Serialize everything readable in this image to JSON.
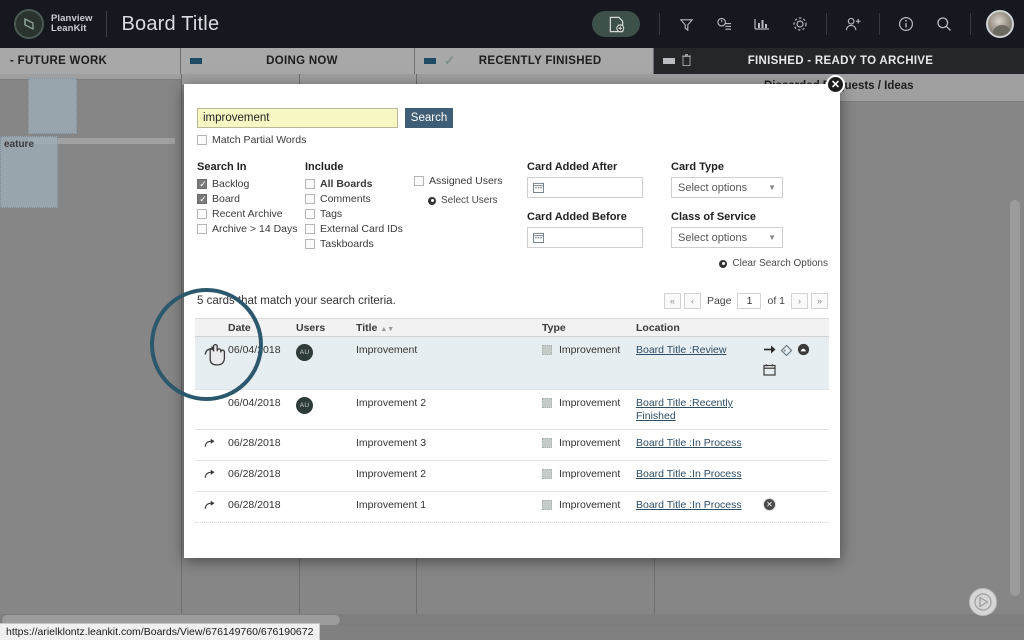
{
  "appbar": {
    "brand_line1": "Planview",
    "brand_line2": "LeanKit",
    "board_title": "Board Title",
    "icons": [
      {
        "name": "add-card-icon",
        "label": "Add Card"
      },
      {
        "name": "filter-icon",
        "label": "Filter"
      },
      {
        "name": "timer-icon",
        "label": "Timeline"
      },
      {
        "name": "analytics-icon",
        "label": "Analytics"
      },
      {
        "name": "gear-icon",
        "label": "Settings"
      },
      {
        "name": "add-user-icon",
        "label": "Add User"
      },
      {
        "name": "info-icon",
        "label": "Info"
      },
      {
        "name": "search-icon",
        "label": "Search"
      },
      {
        "name": "avatar-icon",
        "label": "Account"
      }
    ]
  },
  "board": {
    "lanes": [
      {
        "label": "- FUTURE WORK",
        "collapse": false,
        "check": false,
        "trash": false,
        "dark": false
      },
      {
        "label": "DOING NOW",
        "collapse": true,
        "check": false,
        "trash": false,
        "dark": false
      },
      {
        "label": "RECENTLY FINISHED",
        "collapse": true,
        "check": true,
        "trash": false,
        "dark": false
      },
      {
        "label": "FINISHED - READY TO ARCHIVE",
        "collapse": true,
        "check": false,
        "trash": true,
        "dark": true
      }
    ],
    "sublane_title": "Discarded Requests / Ideas",
    "ghost_card_title": "eature"
  },
  "modal": {
    "close_label": "✕",
    "search": {
      "value": "improvement",
      "placeholder": "",
      "button_label": "Search",
      "match_partial_label": "Match Partial Words",
      "match_partial_checked": false
    },
    "search_in": {
      "heading": "Search In",
      "options": [
        {
          "label": "Backlog",
          "checked": true
        },
        {
          "label": "Board",
          "checked": true
        },
        {
          "label": "Recent Archive",
          "checked": false
        },
        {
          "label": "Archive > 14 Days",
          "checked": false
        }
      ]
    },
    "include": {
      "heading": "Include",
      "options": [
        {
          "label": "All Boards",
          "checked": false,
          "bold": true
        },
        {
          "label": "Comments",
          "checked": false,
          "bold": false
        },
        {
          "label": "Tags",
          "checked": false,
          "bold": false
        },
        {
          "label": "External Card IDs",
          "checked": false,
          "bold": false
        },
        {
          "label": "Taskboards",
          "checked": false,
          "bold": false
        }
      ]
    },
    "users": {
      "assigned_label": "Assigned Users",
      "assigned_checked": false,
      "select_users_label": "Select Users"
    },
    "card_added_after": {
      "heading": "Card Added After",
      "value": ""
    },
    "card_added_before": {
      "heading": "Card Added Before",
      "value": ""
    },
    "card_type": {
      "heading": "Card Type",
      "value": "Select options"
    },
    "class_of_service": {
      "heading": "Class of Service",
      "value": "Select options"
    },
    "clear_search_options": "Clear Search Options",
    "results": {
      "count_text": "5 cards that match your search criteria.",
      "pager": {
        "first": "«",
        "prev": "‹",
        "page_label": "Page",
        "page_value": "1",
        "of_label": "of 1",
        "next": "›",
        "last": "»"
      },
      "columns": [
        "",
        "Date",
        "Users",
        "Title",
        "Type",
        "Location",
        ""
      ],
      "rows": [
        {
          "date": "06/04/2018",
          "user": "AU",
          "title": "Improvement",
          "type": "Improvement",
          "location": "Board Title :Review",
          "highlighted": true,
          "show_actions": true,
          "show_close": false
        },
        {
          "date": "06/04/2018",
          "user": "AU",
          "title": "Improvement 2",
          "type": "Improvement",
          "location": "Board Title :Recently Finished",
          "highlighted": false,
          "show_actions": false,
          "show_close": false
        },
        {
          "date": "06/28/2018",
          "user": "",
          "title": "Improvement 3",
          "type": "Improvement",
          "location": "Board Title :In Process",
          "highlighted": false,
          "show_actions": false,
          "show_close": false
        },
        {
          "date": "06/28/2018",
          "user": "",
          "title": "Improvement 2",
          "type": "Improvement",
          "location": "Board Title :In Process",
          "highlighted": false,
          "show_actions": false,
          "show_close": false
        },
        {
          "date": "06/28/2018",
          "user": "",
          "title": "Improvement 1",
          "type": "Improvement",
          "location": "Board Title :In Process",
          "highlighted": false,
          "show_actions": false,
          "show_close": true
        }
      ]
    }
  },
  "statusbar": {
    "url": "https://arielklontz.leankit.com/Boards/View/676149760/676190672"
  },
  "colors": {
    "appbar_bg": "#15191f",
    "accent": "#3f5d75",
    "annotation_ring": "#2c586e",
    "search_field_bg": "#f7f7c4",
    "row_highlight": "#e7eef1"
  }
}
